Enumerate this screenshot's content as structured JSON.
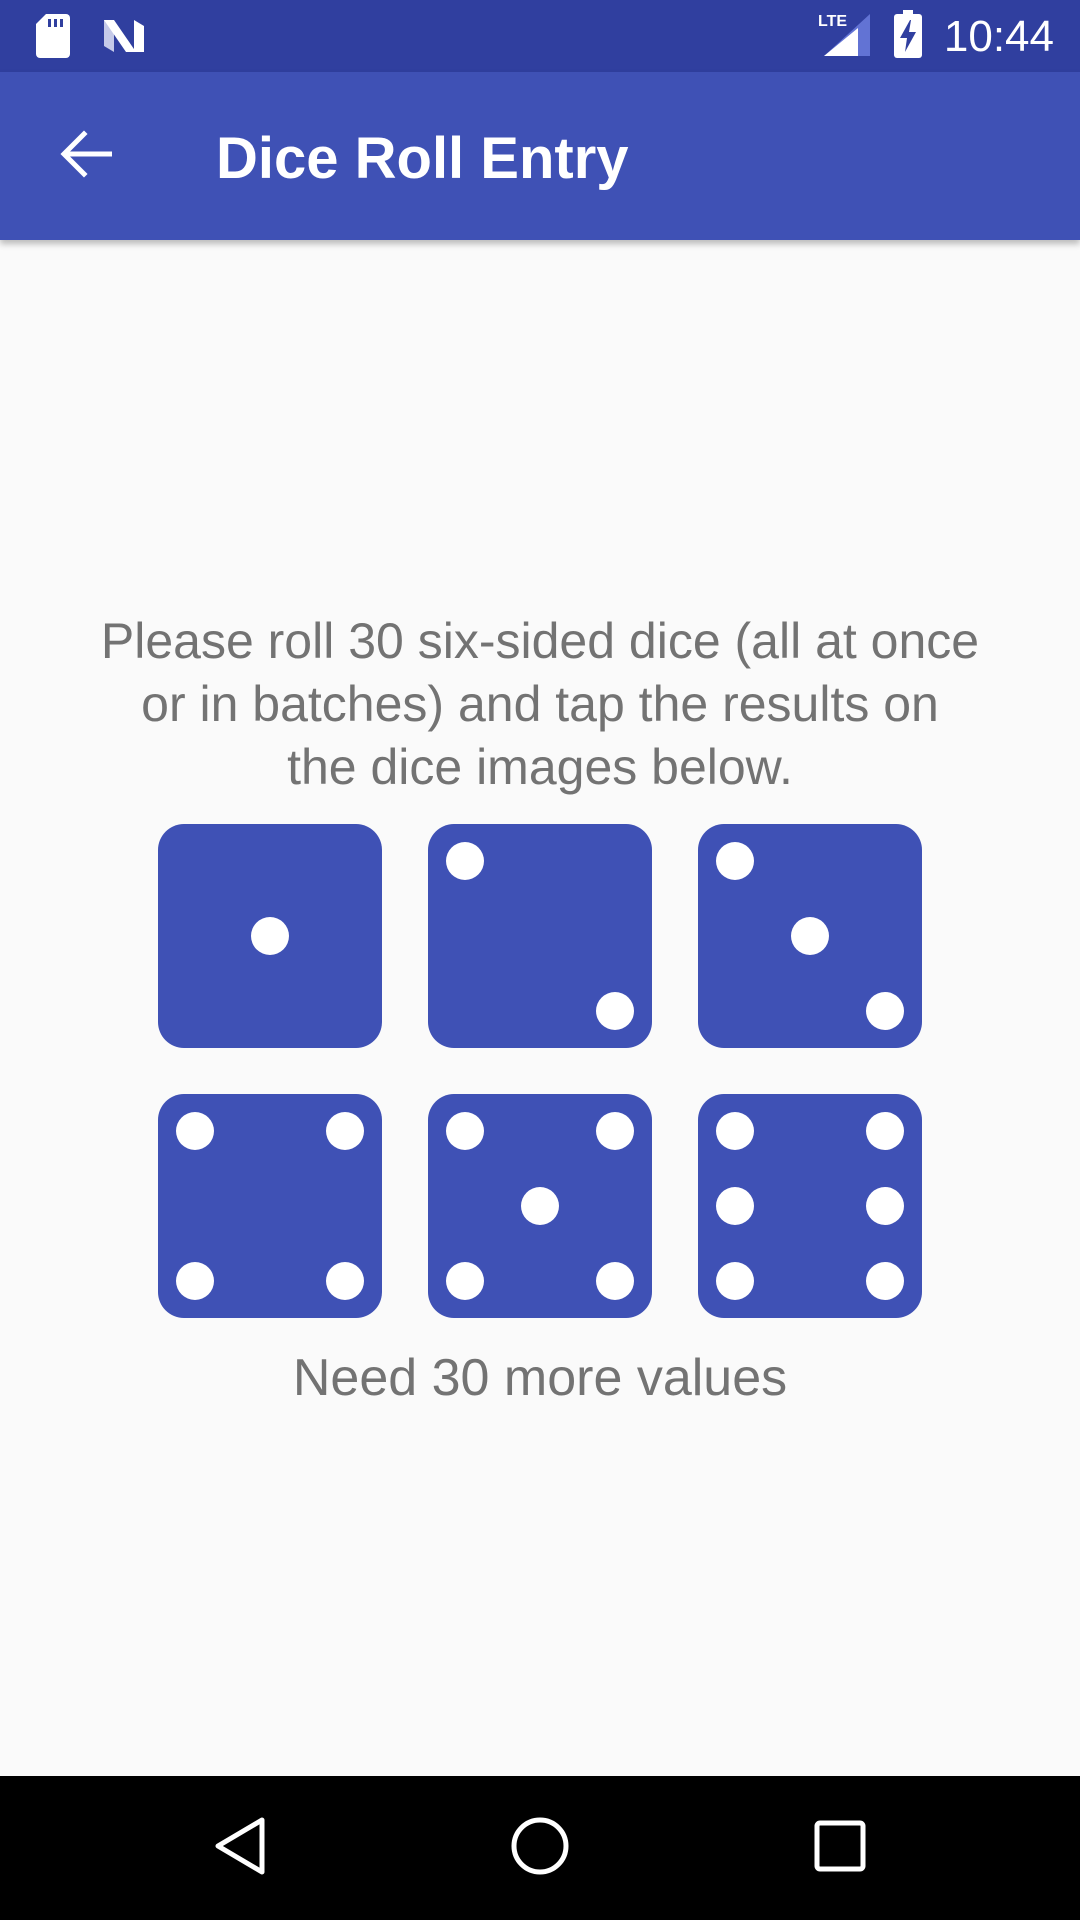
{
  "status_bar": {
    "time": "10:44",
    "network_label": "LTE",
    "icons": [
      "sd-card-icon",
      "n-logo-icon",
      "lte-signal-icon",
      "battery-charging-icon"
    ]
  },
  "app_bar": {
    "title": "Dice Roll Entry",
    "back_icon": "arrow-back-icon"
  },
  "main": {
    "instructions": "Please roll 30 six-sided dice (all at once or in batches) and tap the results on the dice images below.",
    "dice": [
      {
        "value": 1
      },
      {
        "value": 2
      },
      {
        "value": 3
      },
      {
        "value": 4
      },
      {
        "value": 5
      },
      {
        "value": 6
      }
    ],
    "status": "Need 30 more values"
  },
  "nav_bar": {
    "icons": [
      "back-triangle-icon",
      "home-circle-icon",
      "recents-square-icon"
    ]
  },
  "colors": {
    "status_bar": "#303f9f",
    "app_bar": "#3f51b5",
    "dice": "#3f51b5",
    "text": "#737373",
    "background": "#fafafa"
  }
}
